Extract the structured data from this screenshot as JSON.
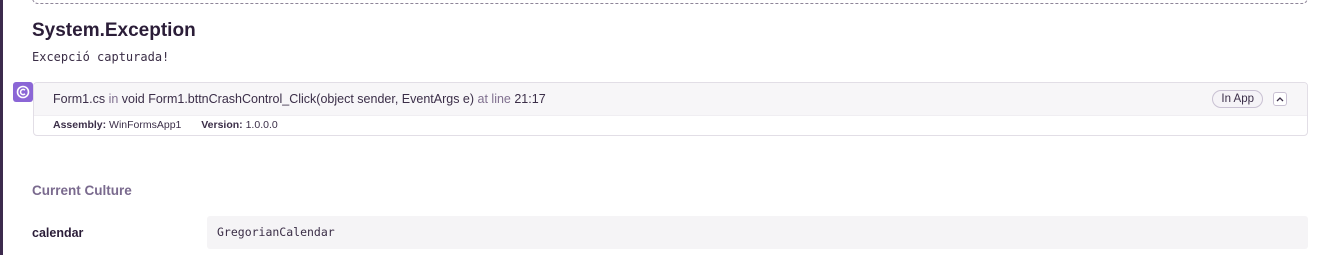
{
  "exception": {
    "type": "System.Exception",
    "value": "Excepció capturada!"
  },
  "frame": {
    "platform_icon": "csharp-icon",
    "filename": "Form1.cs",
    "in_word": "in",
    "function": "void Form1.bttnCrashControl_Click(object sender, EventArgs e)",
    "at_line_word": "at line",
    "line": "21:17",
    "in_app_label": "In App",
    "assembly_label": "Assembly:",
    "assembly_value": "WinFormsApp1",
    "version_label": "Version:",
    "version_value": "1.0.0.0",
    "collapse_icon": "chevron-up-icon"
  },
  "context": {
    "section_title": "Current Culture",
    "rows": [
      {
        "key": "calendar",
        "value": "GregorianCalendar"
      }
    ]
  },
  "colors": {
    "accent": "#8b66d6",
    "text": "#2b1d38",
    "muted": "#80708f"
  }
}
